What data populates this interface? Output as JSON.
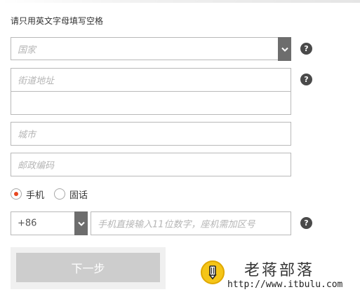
{
  "form": {
    "instruction": "请只用英文字母填写空格",
    "country": {
      "placeholder": "国家"
    },
    "street": {
      "placeholder": "街道地址",
      "line2_placeholder": ""
    },
    "city": {
      "placeholder": "城市"
    },
    "postal": {
      "placeholder": "邮政编码"
    },
    "phone_type": {
      "options": [
        {
          "label": "手机",
          "checked": true
        },
        {
          "label": "固话",
          "checked": false
        }
      ]
    },
    "phone": {
      "country_code": "+86",
      "placeholder": "手机直接输入11位数字，座机需加区号"
    },
    "help_glyph": "?",
    "next_button": "下一步"
  },
  "watermark": {
    "title": "老蒋部落",
    "url": "http://www.itbulu.com"
  },
  "colors": {
    "radio_accent": "#e8461f",
    "select_button_bg": "#6d6d6d",
    "help_icon_bg": "#4a4a4a",
    "next_button_bg": "#cdcdcd",
    "logo_yellow": "#f5c518"
  },
  "icons": {
    "select_arrow": "chevron-down-icon",
    "help": "question-circle-icon",
    "watermark_logo": "pencil-logo-icon"
  }
}
